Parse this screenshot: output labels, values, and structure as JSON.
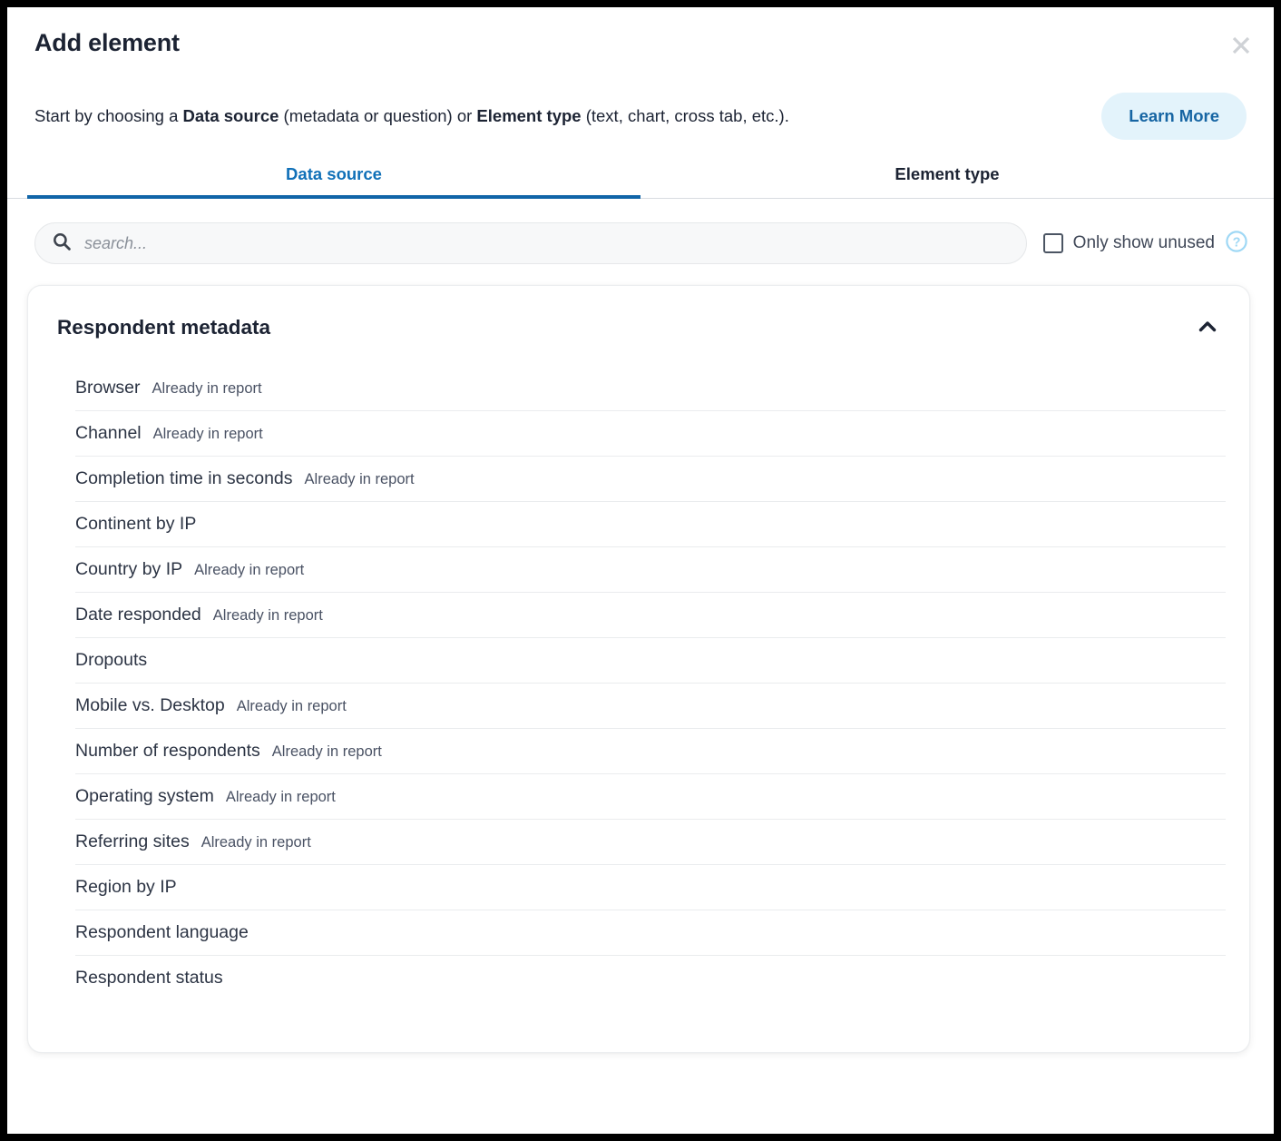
{
  "dialog": {
    "title": "Add element",
    "close_icon": "close-icon",
    "subtitle_parts": [
      {
        "text": "Start by choosing a ",
        "bold": false
      },
      {
        "text": "Data source",
        "bold": true
      },
      {
        "text": " (metadata or question) or ",
        "bold": false
      },
      {
        "text": "Element type",
        "bold": true
      },
      {
        "text": " (text, chart, cross tab, etc.).",
        "bold": false
      }
    ],
    "subtitle_plain": "Start by choosing a Data source (metadata or question) or Element type (text, chart, cross tab, etc.).",
    "learn_more_label": "Learn More"
  },
  "tabs": [
    {
      "label": "Data source",
      "active": true
    },
    {
      "label": "Element type",
      "active": false
    }
  ],
  "search": {
    "placeholder": "search...",
    "value": "",
    "icon": "search-icon"
  },
  "filter": {
    "checkbox_label": "Only show unused",
    "checked": false,
    "help_icon": "help-circle-icon"
  },
  "section": {
    "title": "Respondent metadata",
    "expanded": true,
    "toggle_icon": "chevron-up-icon",
    "items": [
      {
        "name": "Browser",
        "status": "Already in report"
      },
      {
        "name": "Channel",
        "status": "Already in report"
      },
      {
        "name": "Completion time in seconds",
        "status": "Already in report"
      },
      {
        "name": "Continent by IP",
        "status": ""
      },
      {
        "name": "Country by IP",
        "status": "Already in report"
      },
      {
        "name": "Date responded",
        "status": "Already in report"
      },
      {
        "name": "Dropouts",
        "status": ""
      },
      {
        "name": "Mobile vs. Desktop",
        "status": "Already in report"
      },
      {
        "name": "Number of respondents",
        "status": "Already in report"
      },
      {
        "name": "Operating system",
        "status": "Already in report"
      },
      {
        "name": "Referring sites",
        "status": "Already in report"
      },
      {
        "name": "Region by IP",
        "status": ""
      },
      {
        "name": "Respondent language",
        "status": ""
      },
      {
        "name": "Respondent status",
        "status": ""
      }
    ]
  },
  "colors": {
    "accent_blue": "#1065a8",
    "link_blue": "#1070b8",
    "learn_more_bg": "#e3f3fb",
    "text_dark": "#1c2333",
    "help_icon_blue": "#9fd8f5",
    "close_gray": "#cfd2d6"
  }
}
